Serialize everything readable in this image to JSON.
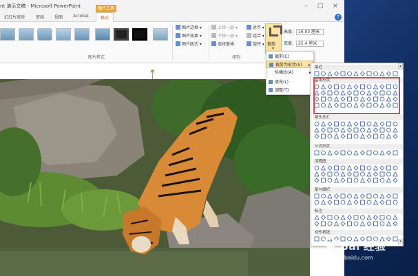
{
  "window": {
    "title": "nt 演示文稿 - Microsoft PowerPoint",
    "context_tab": "图片工具",
    "controls": [
      "–",
      "□",
      "×"
    ]
  },
  "tabs": [
    "幻灯片放映",
    "审阅",
    "视图",
    "Acrobat",
    "格式"
  ],
  "active_tab_index": 4,
  "ribbon": {
    "picture_styles_label": "图片样式",
    "arrange_label": "排列",
    "border_label": "图片边框",
    "effects_label": "图片效果",
    "layout_label": "图片版式",
    "bring_forward": "上移一层",
    "send_backward": "下移一层",
    "selection_pane": "选择窗格",
    "align": "对齐",
    "group": "组合",
    "rotate": "旋转",
    "crop_label": "裁剪",
    "height_label": "高度:",
    "height_value": "16.93 厘米",
    "width_label": "宽度:",
    "width_value": "25.4 厘米"
  },
  "crop_menu": {
    "items": [
      "裁剪(C)",
      "裁剪为形状(S)",
      "纵横比(A)",
      "填充(L)",
      "调整(T)"
    ],
    "highlighted_index": 1
  },
  "shapes_menu": {
    "sections": [
      "最近",
      "基本形状",
      "箭头总汇",
      "公式形状",
      "流程图",
      "星与旗帜",
      "标注",
      "动作按钮"
    ]
  },
  "watermark": {
    "brand": "Bai 经验",
    "url": "jingyan.baidu.com"
  },
  "colors": {
    "accent": "#e2a73a",
    "highlight_border": "#e04646",
    "desktop": "#0f2a5e"
  }
}
